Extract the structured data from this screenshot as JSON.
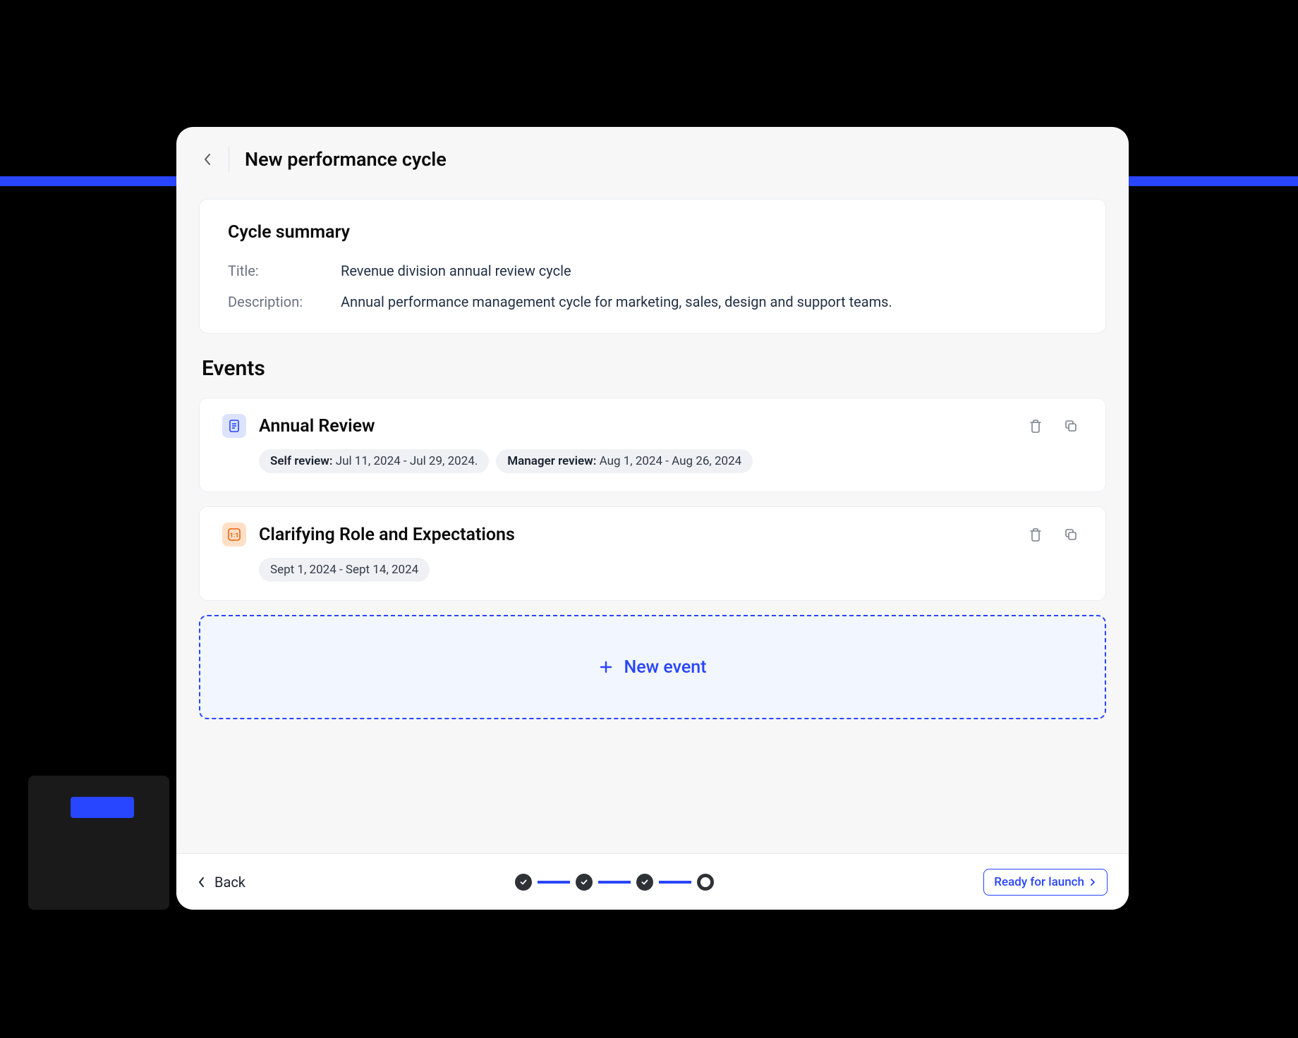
{
  "header": {
    "title": "New performance cycle"
  },
  "summary": {
    "heading": "Cycle summary",
    "title_label": "Title:",
    "title_value": "Revenue division annual review cycle",
    "description_label": "Description:",
    "description_value": "Annual performance management cycle for marketing, sales, design and support teams."
  },
  "events": {
    "heading": "Events",
    "items": [
      {
        "title": "Annual Review",
        "pills": [
          {
            "label": "Self review:",
            "value": "Jul 11, 2024 - Jul 29, 2024."
          },
          {
            "label": "Manager review:",
            "value": "Aug 1, 2024 - Aug 26, 2024"
          }
        ]
      },
      {
        "title": "Clarifying Role and Expectations",
        "pills": [
          {
            "label": "",
            "value": "Sept 1, 2024 - Sept 14, 2024"
          }
        ]
      }
    ],
    "new_event_label": "New event"
  },
  "footer": {
    "back_label": "Back",
    "launch_label": "Ready for launch",
    "steps_done": 3,
    "steps_total": 4
  }
}
